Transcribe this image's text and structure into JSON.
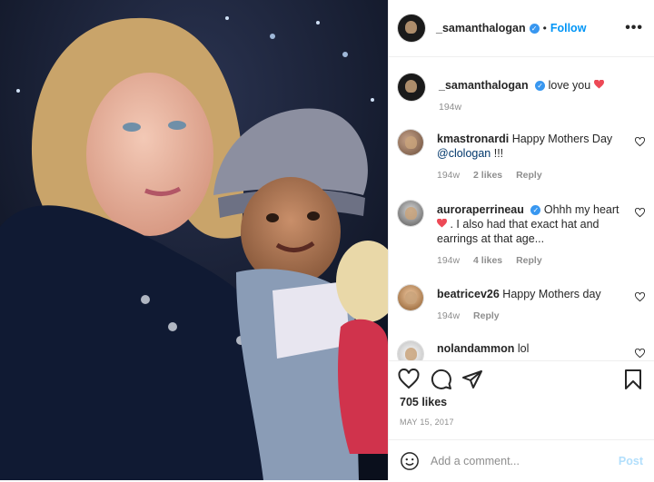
{
  "header": {
    "username": "_samanthalogan",
    "separator": "•",
    "follow_label": "Follow",
    "more_label": "•••"
  },
  "caption": {
    "username": "_samanthalogan",
    "text": "love you",
    "time": "194w"
  },
  "comments": [
    {
      "username": "kmastronardi",
      "text": "Happy Mothers Day",
      "mention": "@clologan",
      "suffix": " !!!",
      "time": "194w",
      "likes": "2 likes",
      "reply": "Reply"
    },
    {
      "username": "auroraperrineau",
      "text": "Ohhh my heart",
      "text2": " . I also had that exact hat and earrings at that age...",
      "time": "194w",
      "likes": "4 likes",
      "reply": "Reply"
    },
    {
      "username": "beatricev26",
      "text": "Happy Mothers day",
      "time": "194w",
      "reply": "Reply"
    },
    {
      "username": "nolandammon",
      "text": "lol"
    }
  ],
  "actions": {
    "likes": "705 likes",
    "date": "MAY 15, 2017"
  },
  "add_comment": {
    "placeholder": "Add a comment...",
    "post_label": "Post"
  },
  "colors": {
    "accent": "#0095f6",
    "verified": "#3897f0",
    "heart": "#ed4956"
  }
}
